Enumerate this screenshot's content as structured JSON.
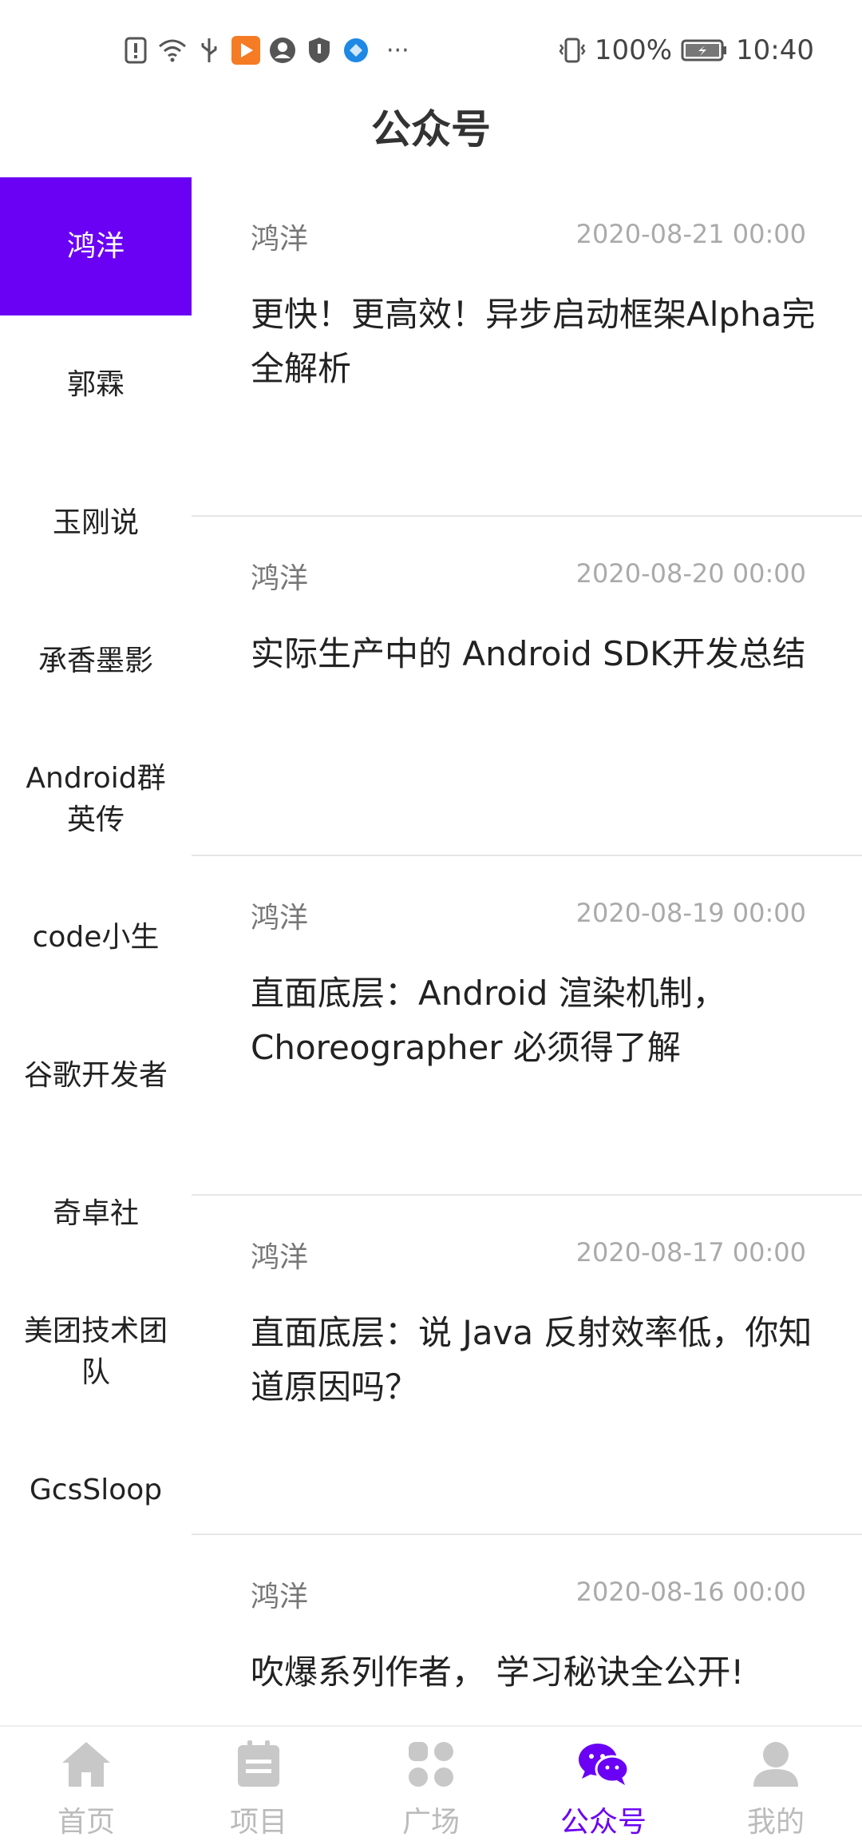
{
  "status_bar": {
    "battery_percent": "100%",
    "time": "10:40",
    "more": "···"
  },
  "page_title": "公众号",
  "sidebar": {
    "items": [
      {
        "label": "鸿洋",
        "active": true
      },
      {
        "label": "郭霖",
        "active": false
      },
      {
        "label": "玉刚说",
        "active": false
      },
      {
        "label": "承香墨影",
        "active": false
      },
      {
        "label": "Android群英传",
        "active": false
      },
      {
        "label": "code小生",
        "active": false
      },
      {
        "label": "谷歌开发者",
        "active": false
      },
      {
        "label": "奇卓社",
        "active": false
      },
      {
        "label": "美团技术团队",
        "active": false
      },
      {
        "label": "GcsSloop",
        "active": false
      },
      {
        "label": "",
        "active": false
      }
    ]
  },
  "articles": [
    {
      "author": "鸿洋",
      "date": "2020-08-21 00:00",
      "title": "更快！更高效！异步启动框架Alpha完全解析"
    },
    {
      "author": "鸿洋",
      "date": "2020-08-20 00:00",
      "title": "实际生产中的 Android SDK开发总结"
    },
    {
      "author": "鸿洋",
      "date": "2020-08-19 00:00",
      "title": "直面底层：Android 渲染机制，Choreographer 必须得了解"
    },
    {
      "author": "鸿洋",
      "date": "2020-08-17 00:00",
      "title": "直面底层：说 Java 反射效率低，你知道原因吗？"
    },
    {
      "author": "鸿洋",
      "date": "2020-08-16 00:00",
      "title": "吹爆系列作者， 学习秘诀全公开!"
    }
  ],
  "bottom_nav": {
    "items": [
      {
        "label": "首页",
        "icon": "home-icon",
        "active": false
      },
      {
        "label": "项目",
        "icon": "project-icon",
        "active": false
      },
      {
        "label": "广场",
        "icon": "square-icon",
        "active": false
      },
      {
        "label": "公众号",
        "icon": "wechat-icon",
        "active": true
      },
      {
        "label": "我的",
        "icon": "profile-icon",
        "active": false
      }
    ]
  },
  "colors": {
    "accent": "#6a00f4",
    "inactive_nav": "#bbbbbb"
  }
}
